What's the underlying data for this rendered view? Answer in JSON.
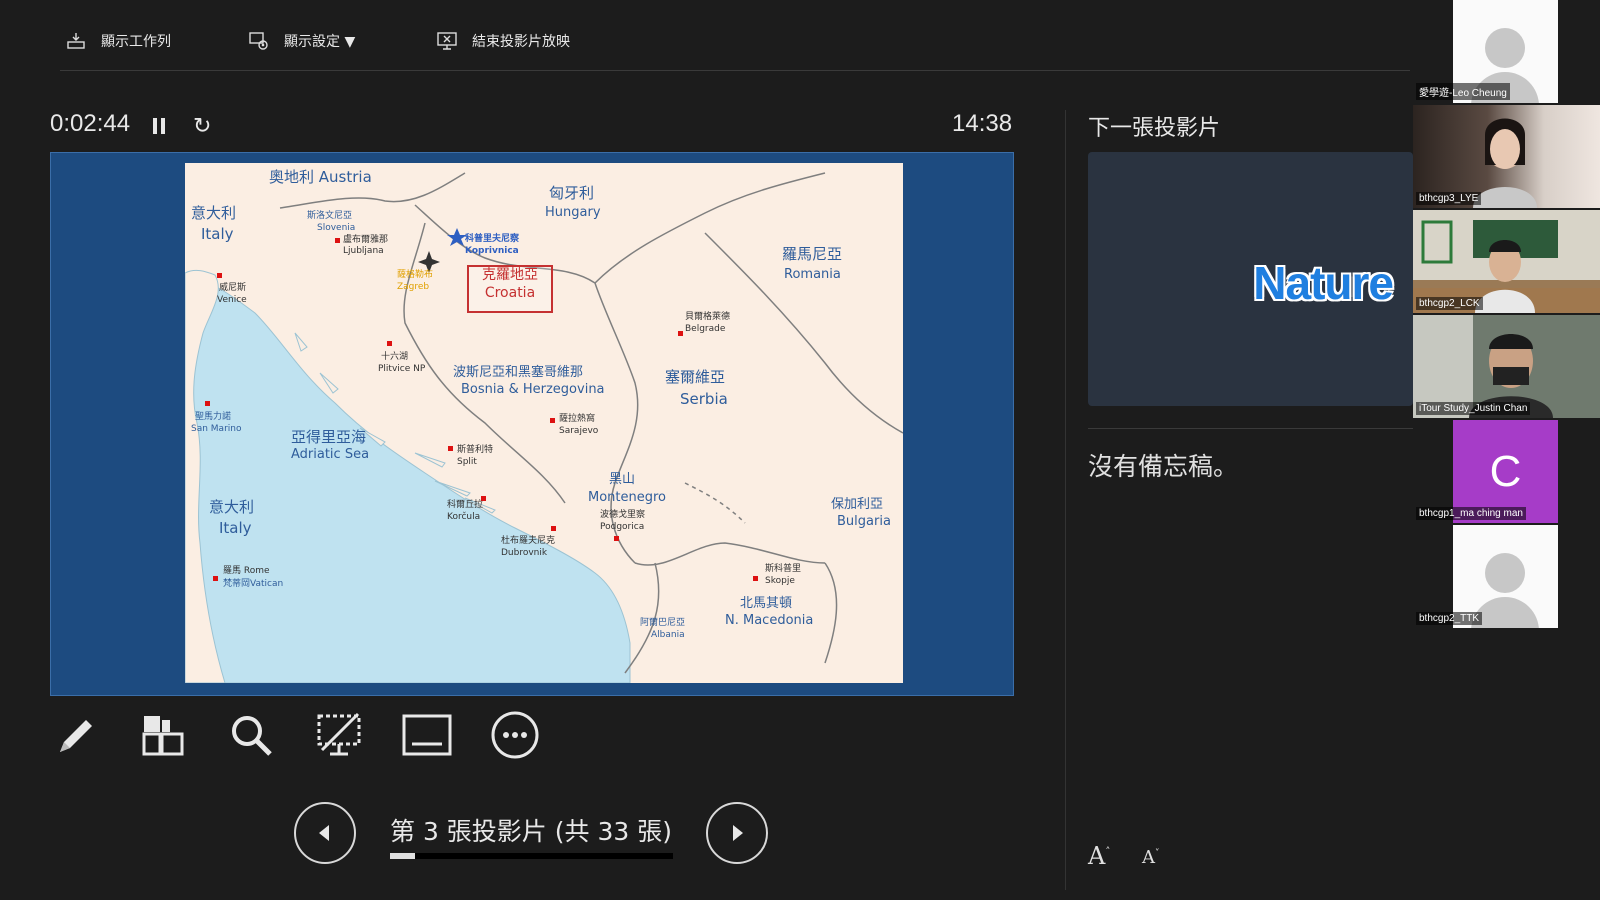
{
  "toolbar": {
    "taskbar": "顯示工作列",
    "display_settings": "顯示設定 ▼",
    "end_show": "結束投影片放映"
  },
  "presenter": {
    "elapsed": "0:02:44",
    "clock": "14:38",
    "slide_counter": "第 3 張投影片 (共 33 張)",
    "progress": 0.09
  },
  "next_slide": {
    "label": "下一張投影片",
    "preview_text": "Nature"
  },
  "notes": {
    "text": "沒有備忘稿。"
  },
  "map": {
    "austria": "奧地利 Austria",
    "italy_north_zh": "意大利",
    "italy_north_en": "Italy",
    "slovenia_zh": "斯洛文尼亞",
    "slovenia_en": "Slovenia",
    "ljubljana_zh": "盧布爾雅那",
    "ljubljana_en": "Ljubljana",
    "venice_zh": "威尼斯",
    "venice_en": "Venice",
    "zagreb_zh": "薩格勒布",
    "zagreb_en": "Zagreb",
    "koprivnica_zh": "科普里夫尼察",
    "koprivnica_en": "Koprivnica",
    "hungary_zh": "匈牙利",
    "hungary_en": "Hungary",
    "croatia_zh": "克羅地亞",
    "croatia_en": "Croatia",
    "romania_zh": "羅馬尼亞",
    "romania_en": "Romania",
    "belgrade_zh": "貝爾格萊德",
    "belgrade_en": "Belgrade",
    "plitvice_zh": "十六湖",
    "plitvice_en": "Plitvice NP",
    "bosnia_zh": "波斯尼亞和黑塞哥維那",
    "bosnia_en": "Bosnia & Herzegovina",
    "serbia_zh": "塞爾維亞",
    "serbia_en": "Serbia",
    "sanmarino_zh": "聖馬力諾",
    "sanmarino_en": "San Marino",
    "adriatic_zh": "亞得里亞海",
    "adriatic_en": "Adriatic Sea",
    "sarajevo_zh": "薩拉熱窩",
    "sarajevo_en": "Sarajevo",
    "split_zh": "斯普利特",
    "split_en": "Split",
    "italy_south_zh": "意大利",
    "italy_south_en": "Italy",
    "montenegro_zh": "黑山",
    "montenegro_en": "Montenegro",
    "podgorica_zh": "波德戈里察",
    "podgorica_en": "Podgorica",
    "korcula_zh": "科爾丘拉",
    "korcula_en": "Korčula",
    "dubrovnik_zh": "杜布羅夫尼克",
    "dubrovnik_en": "Dubrovnik",
    "bulgaria_zh": "保加利亞",
    "bulgaria_en": "Bulgaria",
    "rome_zh": "羅馬 Rome",
    "vatican_zh": "梵蒂岡Vatican",
    "skopje_zh": "斯科普里",
    "skopje_en": "Skopje",
    "macedonia_zh": "北馬其頓",
    "macedonia_en": "N. Macedonia",
    "albania_zh": "阿爾巴尼亞",
    "albania_en": "Albania"
  },
  "participants": [
    {
      "name": "愛學遊-Leo Cheung"
    },
    {
      "name": "bthcgp3_LYE"
    },
    {
      "name": "bthcgp2_LCK"
    },
    {
      "name": "iTour Study_Justin Chan"
    },
    {
      "name": "bthcgp1_ma ching man",
      "initial": "C"
    },
    {
      "name": "bthcgp2_TTK"
    }
  ],
  "colors": {
    "background": "#1c1c1c",
    "slide_bg": "#1d4b80",
    "sea": "#bfe2f0",
    "land": "#fbeee3",
    "croatia_red": "#c53131",
    "avatar_purple": "#a63cc8"
  }
}
